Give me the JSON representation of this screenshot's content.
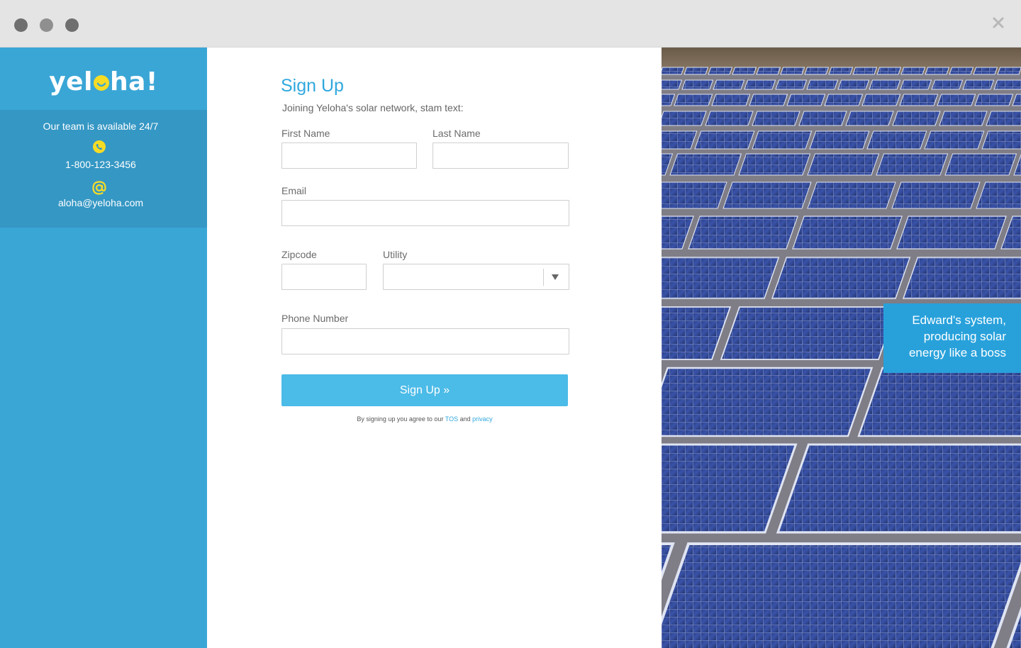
{
  "window": {
    "close_glyph": "✕"
  },
  "sidebar": {
    "logo": {
      "before": "yel",
      "after": "ha!"
    },
    "availability": "Our team is available 24/7",
    "phone": "1-800-123-3456",
    "email": "aloha@yeloha.com",
    "icons": {
      "phone": "phone-icon",
      "email": "at-sign-icon"
    }
  },
  "form": {
    "title": "Sign Up",
    "subtitle": "Joining Yeloha's solar network, stam text:",
    "first_name_label": "First Name",
    "last_name_label": "Last Name",
    "email_label": "Email",
    "zipcode_label": "Zipcode",
    "utility_label": "Utility",
    "phone_label": "Phone Number",
    "submit_label": "Sign Up »",
    "terms": {
      "prefix": "By signing up you agree to our ",
      "tos": "TOS",
      "middle": " and ",
      "privacy": "privacy"
    }
  },
  "photo": {
    "caption_lines": [
      "Edward's system,",
      "producing solar",
      "energy like a boss"
    ]
  },
  "colors": {
    "sidebar": "#3aa6d6",
    "contact_box": "#3597c4",
    "accent": "#30a8de",
    "button": "#4bbbe8",
    "logo_dot": "#f7dc25",
    "caption_bg": "#28a1db"
  }
}
